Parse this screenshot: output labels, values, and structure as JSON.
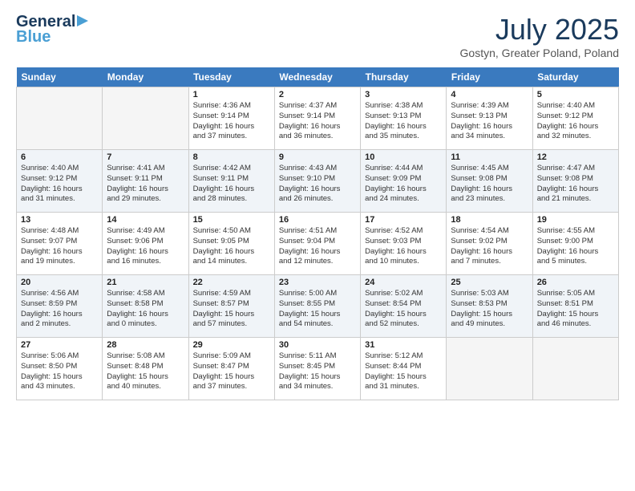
{
  "header": {
    "logo_general": "General",
    "logo_blue": "Blue",
    "month_year": "July 2025",
    "location": "Gostyn, Greater Poland, Poland"
  },
  "weekdays": [
    "Sunday",
    "Monday",
    "Tuesday",
    "Wednesday",
    "Thursday",
    "Friday",
    "Saturday"
  ],
  "weeks": [
    [
      {
        "day": "",
        "info": ""
      },
      {
        "day": "",
        "info": ""
      },
      {
        "day": "1",
        "info": "Sunrise: 4:36 AM\nSunset: 9:14 PM\nDaylight: 16 hours\nand 37 minutes."
      },
      {
        "day": "2",
        "info": "Sunrise: 4:37 AM\nSunset: 9:14 PM\nDaylight: 16 hours\nand 36 minutes."
      },
      {
        "day": "3",
        "info": "Sunrise: 4:38 AM\nSunset: 9:13 PM\nDaylight: 16 hours\nand 35 minutes."
      },
      {
        "day": "4",
        "info": "Sunrise: 4:39 AM\nSunset: 9:13 PM\nDaylight: 16 hours\nand 34 minutes."
      },
      {
        "day": "5",
        "info": "Sunrise: 4:40 AM\nSunset: 9:12 PM\nDaylight: 16 hours\nand 32 minutes."
      }
    ],
    [
      {
        "day": "6",
        "info": "Sunrise: 4:40 AM\nSunset: 9:12 PM\nDaylight: 16 hours\nand 31 minutes."
      },
      {
        "day": "7",
        "info": "Sunrise: 4:41 AM\nSunset: 9:11 PM\nDaylight: 16 hours\nand 29 minutes."
      },
      {
        "day": "8",
        "info": "Sunrise: 4:42 AM\nSunset: 9:11 PM\nDaylight: 16 hours\nand 28 minutes."
      },
      {
        "day": "9",
        "info": "Sunrise: 4:43 AM\nSunset: 9:10 PM\nDaylight: 16 hours\nand 26 minutes."
      },
      {
        "day": "10",
        "info": "Sunrise: 4:44 AM\nSunset: 9:09 PM\nDaylight: 16 hours\nand 24 minutes."
      },
      {
        "day": "11",
        "info": "Sunrise: 4:45 AM\nSunset: 9:08 PM\nDaylight: 16 hours\nand 23 minutes."
      },
      {
        "day": "12",
        "info": "Sunrise: 4:47 AM\nSunset: 9:08 PM\nDaylight: 16 hours\nand 21 minutes."
      }
    ],
    [
      {
        "day": "13",
        "info": "Sunrise: 4:48 AM\nSunset: 9:07 PM\nDaylight: 16 hours\nand 19 minutes."
      },
      {
        "day": "14",
        "info": "Sunrise: 4:49 AM\nSunset: 9:06 PM\nDaylight: 16 hours\nand 16 minutes."
      },
      {
        "day": "15",
        "info": "Sunrise: 4:50 AM\nSunset: 9:05 PM\nDaylight: 16 hours\nand 14 minutes."
      },
      {
        "day": "16",
        "info": "Sunrise: 4:51 AM\nSunset: 9:04 PM\nDaylight: 16 hours\nand 12 minutes."
      },
      {
        "day": "17",
        "info": "Sunrise: 4:52 AM\nSunset: 9:03 PM\nDaylight: 16 hours\nand 10 minutes."
      },
      {
        "day": "18",
        "info": "Sunrise: 4:54 AM\nSunset: 9:02 PM\nDaylight: 16 hours\nand 7 minutes."
      },
      {
        "day": "19",
        "info": "Sunrise: 4:55 AM\nSunset: 9:00 PM\nDaylight: 16 hours\nand 5 minutes."
      }
    ],
    [
      {
        "day": "20",
        "info": "Sunrise: 4:56 AM\nSunset: 8:59 PM\nDaylight: 16 hours\nand 2 minutes."
      },
      {
        "day": "21",
        "info": "Sunrise: 4:58 AM\nSunset: 8:58 PM\nDaylight: 16 hours\nand 0 minutes."
      },
      {
        "day": "22",
        "info": "Sunrise: 4:59 AM\nSunset: 8:57 PM\nDaylight: 15 hours\nand 57 minutes."
      },
      {
        "day": "23",
        "info": "Sunrise: 5:00 AM\nSunset: 8:55 PM\nDaylight: 15 hours\nand 54 minutes."
      },
      {
        "day": "24",
        "info": "Sunrise: 5:02 AM\nSunset: 8:54 PM\nDaylight: 15 hours\nand 52 minutes."
      },
      {
        "day": "25",
        "info": "Sunrise: 5:03 AM\nSunset: 8:53 PM\nDaylight: 15 hours\nand 49 minutes."
      },
      {
        "day": "26",
        "info": "Sunrise: 5:05 AM\nSunset: 8:51 PM\nDaylight: 15 hours\nand 46 minutes."
      }
    ],
    [
      {
        "day": "27",
        "info": "Sunrise: 5:06 AM\nSunset: 8:50 PM\nDaylight: 15 hours\nand 43 minutes."
      },
      {
        "day": "28",
        "info": "Sunrise: 5:08 AM\nSunset: 8:48 PM\nDaylight: 15 hours\nand 40 minutes."
      },
      {
        "day": "29",
        "info": "Sunrise: 5:09 AM\nSunset: 8:47 PM\nDaylight: 15 hours\nand 37 minutes."
      },
      {
        "day": "30",
        "info": "Sunrise: 5:11 AM\nSunset: 8:45 PM\nDaylight: 15 hours\nand 34 minutes."
      },
      {
        "day": "31",
        "info": "Sunrise: 5:12 AM\nSunset: 8:44 PM\nDaylight: 15 hours\nand 31 minutes."
      },
      {
        "day": "",
        "info": ""
      },
      {
        "day": "",
        "info": ""
      }
    ]
  ]
}
